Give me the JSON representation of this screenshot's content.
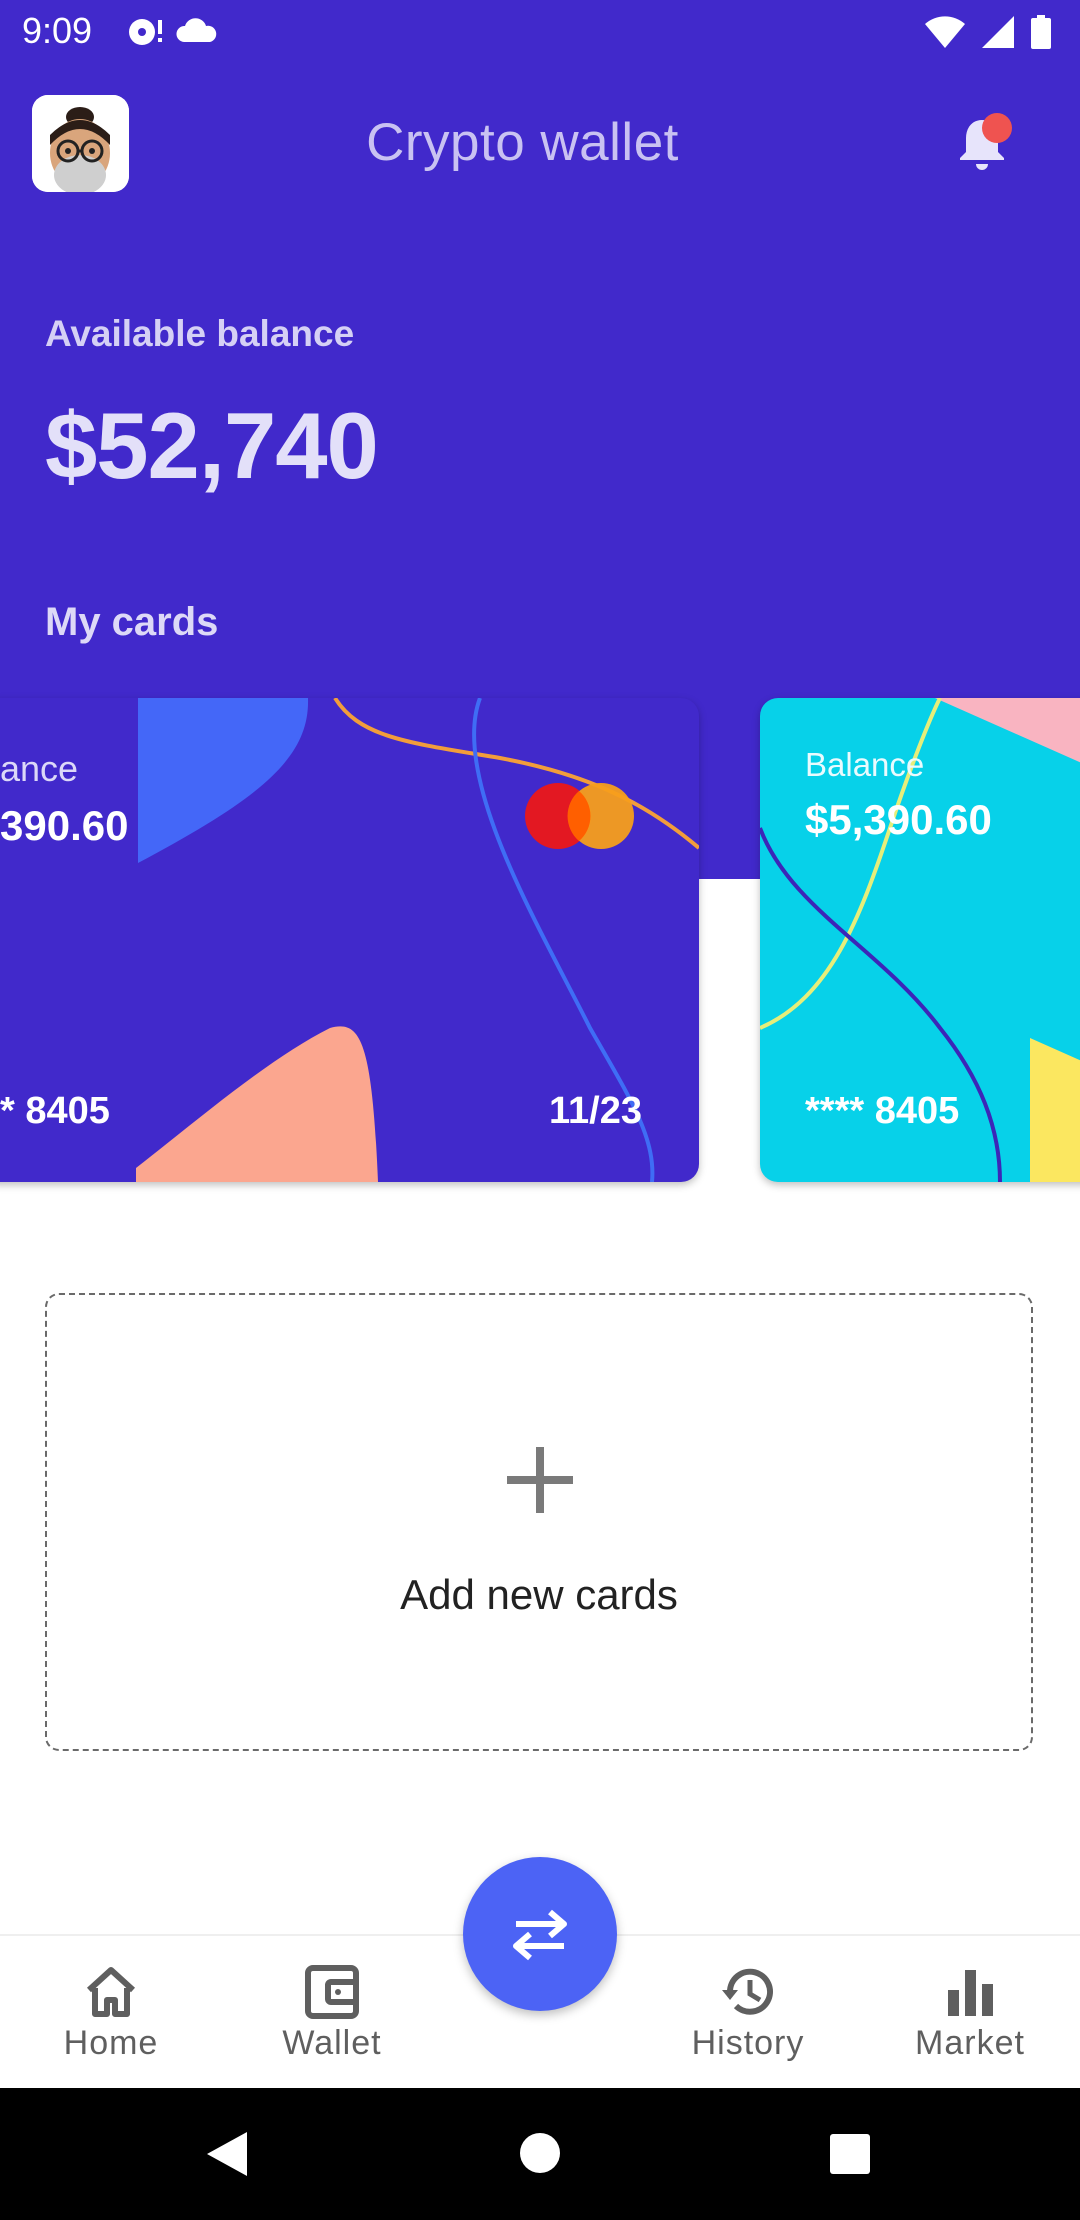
{
  "status_bar": {
    "time": "9:09"
  },
  "app_bar": {
    "title": "Crypto wallet"
  },
  "balance": {
    "label": "Available balance",
    "value": "$52,740"
  },
  "cards_section": {
    "title": "My cards"
  },
  "cards": [
    {
      "label": "ance",
      "amount": "390.60",
      "number": "*  8405",
      "expiry": "11/23",
      "color": "#4129cb"
    },
    {
      "label": "Balance",
      "amount": "$5,390.60",
      "number": "****  8405",
      "color": "#07d1e9"
    }
  ],
  "add_card": {
    "label": "Add new cards"
  },
  "bottom_nav": {
    "items": [
      {
        "label": "Home",
        "icon": "home-icon"
      },
      {
        "label": "Wallet",
        "icon": "wallet-icon"
      },
      {
        "label": "History",
        "icon": "history-icon"
      },
      {
        "label": "Market",
        "icon": "bar-chart-icon"
      }
    ],
    "fab_icon": "swap-arrows-icon"
  },
  "colors": {
    "primary": "#4129cb",
    "accent": "#4c63f5",
    "notification": "#ef5350",
    "card_cyan": "#07d1e9"
  }
}
